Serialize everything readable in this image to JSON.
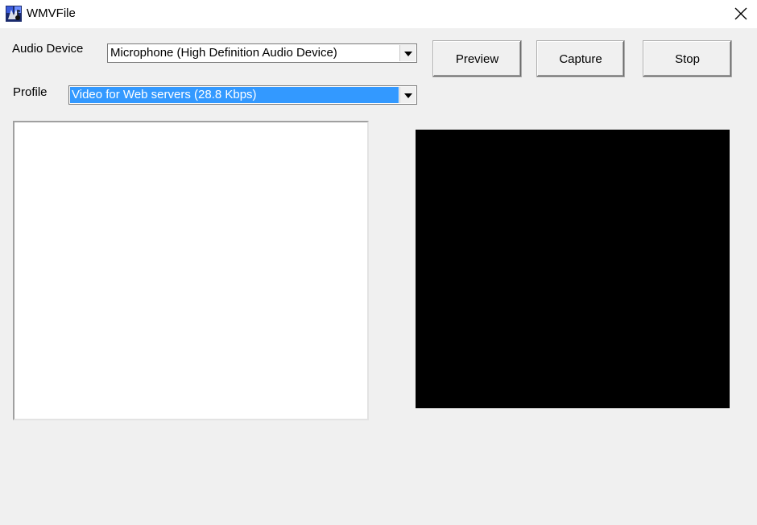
{
  "window": {
    "title": "WMVFile",
    "icon": "wmv-app-icon",
    "close_icon": "close-icon"
  },
  "audio_device": {
    "label": "Audio Device",
    "selected": "Microphone (High Definition Audio Device)"
  },
  "profile": {
    "label": "Profile",
    "selected": "Video for Web servers (28.8 Kbps)"
  },
  "buttons": {
    "preview": "Preview",
    "capture": "Capture",
    "stop": "Stop"
  },
  "colors": {
    "selection_highlight": "#3399ff",
    "preview_background": "#000000",
    "window_background": "#f0f0f0"
  }
}
